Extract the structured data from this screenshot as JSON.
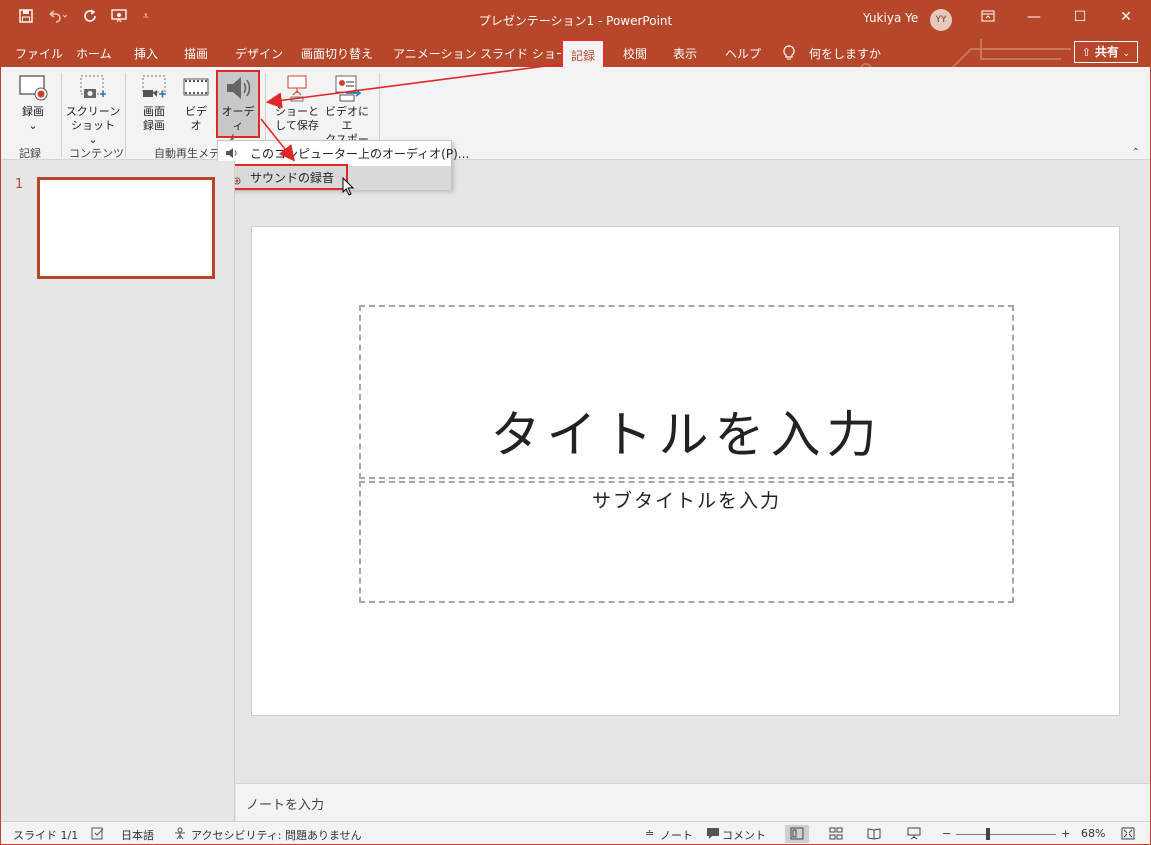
{
  "window": {
    "title": "プレゼンテーション1 - PowerPoint",
    "user_name": "Yukiya Ye",
    "user_initials": "YY"
  },
  "tabs": [
    {
      "label": "ファイル"
    },
    {
      "label": "ホーム"
    },
    {
      "label": "挿入"
    },
    {
      "label": "描画"
    },
    {
      "label": "デザイン"
    },
    {
      "label": "画面切り替え"
    },
    {
      "label": "アニメーション"
    },
    {
      "label": "スライド ショー"
    },
    {
      "label": "記録"
    },
    {
      "label": "校閲"
    },
    {
      "label": "表示"
    },
    {
      "label": "ヘルプ"
    }
  ],
  "tell_me": "何をしますか",
  "share_label": "共有",
  "ribbon": {
    "record": {
      "line1": "録画",
      "line2": "⌄"
    },
    "screenshot": {
      "line1": "スクリーン",
      "line2": "ショット ⌄"
    },
    "screen_recording": {
      "line1": "画面",
      "line2": "録画"
    },
    "video": {
      "line1": "ビデ",
      "line2": "オ"
    },
    "audio": {
      "line1": "オーディ",
      "line2": "オ ⌄"
    },
    "save_as_show": {
      "line1": "ショーと",
      "line2": "して保存"
    },
    "export_video": {
      "line1": "ビデオにエ",
      "line2": "クスポート"
    },
    "groups": {
      "record": "記録",
      "content": "コンテンツ",
      "autoplay": "自動再生メデ"
    }
  },
  "audio_menu": {
    "items": [
      {
        "label": "このコンピューター上のオーディオ(P)..."
      },
      {
        "label": "サウンドの録音"
      }
    ]
  },
  "slide_panel": {
    "slide_number": "1"
  },
  "slide": {
    "title_placeholder": "タイトルを入力",
    "subtitle_placeholder": "サブタイトルを入力"
  },
  "notes_placeholder": "ノートを入力",
  "status": {
    "slide": "スライド 1/1",
    "language": "日本語",
    "accessibility": "アクセシビリティ: 問題ありません",
    "notes": "ノート",
    "comments": "コメント",
    "zoom": "68%"
  },
  "colors": {
    "accent": "#b7472a",
    "highlight_box": "#e02828"
  }
}
